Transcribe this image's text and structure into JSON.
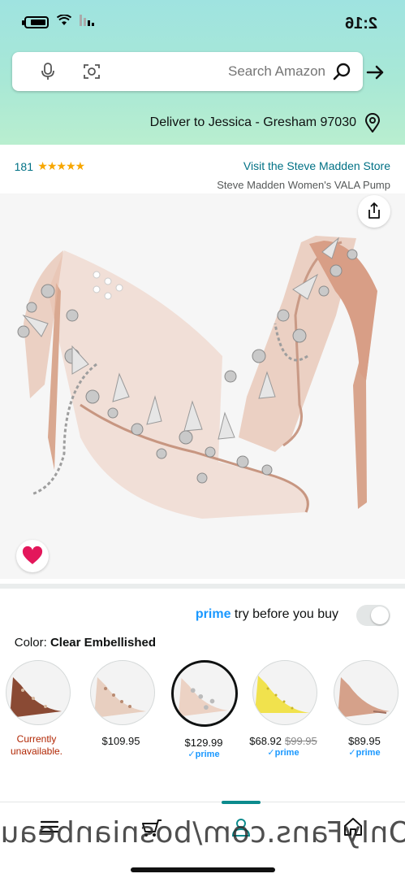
{
  "status_bar": {
    "time": "2:16"
  },
  "search": {
    "placeholder": "Search Amazon"
  },
  "deliver": {
    "text": "Deliver to Jessica - Gresham 97030"
  },
  "product": {
    "store_link": "Visit the Steve Madden Store",
    "stars": "★★★★★",
    "rating_count": "181",
    "title": "Steve Madden Women's VALA Pump"
  },
  "prime_try": {
    "prime": "prime",
    "text": "try before you buy",
    "toggle_on": false
  },
  "color": {
    "label": "Color:",
    "value": "Clear Embellished"
  },
  "variants": [
    {
      "price": "$89.95",
      "strike": "",
      "prime": "✓prime",
      "unavailable": ""
    },
    {
      "price": "$68.92",
      "strike": "$99.95",
      "prime": "✓prime",
      "unavailable": ""
    },
    {
      "price": "$129.99",
      "strike": "",
      "prime": "✓prime",
      "unavailable": ""
    },
    {
      "price": "$109.95",
      "strike": "",
      "prime": "",
      "unavailable": ""
    },
    {
      "price": "",
      "strike": "",
      "prime": "",
      "unavailable_line1": "Currently",
      "unavailable_line2": "unavailable."
    }
  ],
  "watermark": "OnlyFans.com/bosnianbeau",
  "colors": {
    "header_top": "#9fe3e0",
    "header_bottom": "#b9eecf",
    "link": "#007185",
    "prime": "#1a98ff",
    "heart": "#e3175b"
  },
  "icons": [
    "back-arrow-icon",
    "search-icon",
    "camera-icon",
    "mic-icon",
    "location-pin-icon",
    "share-icon",
    "heart-icon",
    "home-icon",
    "account-icon",
    "cart-icon",
    "menu-icon"
  ]
}
